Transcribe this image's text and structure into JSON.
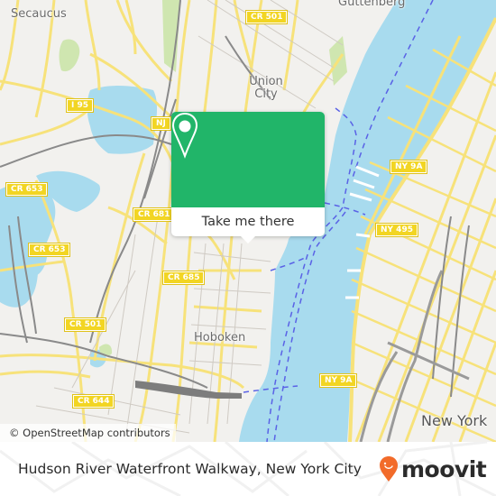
{
  "map": {
    "place_labels": [
      {
        "name": "secaucus",
        "text": "Secaucus"
      },
      {
        "name": "guttenberg",
        "text": "Guttenberg"
      },
      {
        "name": "union-city",
        "text": "Union City"
      },
      {
        "name": "hoboken",
        "text": "Hoboken"
      },
      {
        "name": "new-york",
        "text": "New York"
      }
    ],
    "route_shields": [
      {
        "name": "cr-501-north",
        "text": "CR 501"
      },
      {
        "name": "i-95",
        "text": "I 95"
      },
      {
        "name": "nj",
        "text": "NJ"
      },
      {
        "name": "cr-653-west",
        "text": "CR 653"
      },
      {
        "name": "cr-681",
        "text": "CR 681"
      },
      {
        "name": "cr-653-south",
        "text": "CR 653"
      },
      {
        "name": "cr-685",
        "text": "CR 685"
      },
      {
        "name": "cr-501-south",
        "text": "CR 501"
      },
      {
        "name": "cr-644",
        "text": "CR 644"
      },
      {
        "name": "ny-9a-north",
        "text": "NY 9A"
      },
      {
        "name": "ny-495",
        "text": "NY 495"
      },
      {
        "name": "ny-9a-south",
        "text": "NY 9A"
      }
    ],
    "attribution": "© OpenStreetMap contributors",
    "colors": {
      "land": "#f2f1ee",
      "water": "#a8dbee",
      "road": "#f7e27a",
      "park": "#cfe6b0",
      "rail": "#8a8a8a",
      "ferry": "#5a62e6"
    }
  },
  "popup": {
    "icon": "location-pin-icon",
    "cta_label": "Take me there",
    "accent_color": "#21b569"
  },
  "footer": {
    "title": "Hudson River Waterfront Walkway, New York City",
    "brand": {
      "name": "moovit",
      "icon": "moovit-smile-pin-icon",
      "accent_color": "#f26b2a"
    }
  }
}
